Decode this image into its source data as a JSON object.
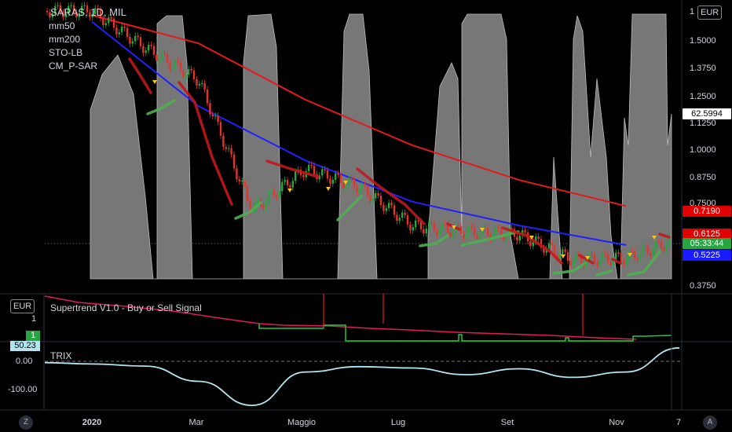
{
  "header": {
    "symbol": "SARAS, 1D, MIL",
    "indicators": [
      "mm50",
      "mm200",
      "STO-LB",
      "CM_P-SAR"
    ]
  },
  "currency": "EUR",
  "price_axis": {
    "ticks": [
      "1.5000",
      "1.3750",
      "1.2500",
      "1.1250",
      "1.0000",
      "0.8750",
      "0.7500",
      "0.3750"
    ],
    "top_partial": "1",
    "tags": [
      {
        "text": "62.5994",
        "bg": "#ffffff",
        "fg": "#000000"
      },
      {
        "text": "0.7190",
        "bg": "#e00000",
        "fg": "#ffffff"
      },
      {
        "text": "0.6125",
        "bg": "#e00000",
        "fg": "#ffffff"
      },
      {
        "text": "05:33:44",
        "bg": "#26a641",
        "fg": "#ffffff"
      },
      {
        "text": "0.5225",
        "bg": "#1a1aff",
        "fg": "#ffffff"
      }
    ]
  },
  "panes": {
    "supertrend": {
      "title": "Supertrend V1.0 - Buy or Sell Signal",
      "currency": "EUR",
      "tick": "1",
      "tag": "1"
    },
    "trix": {
      "title": "TRIX",
      "tag": "50.23",
      "ticks": [
        "0.00",
        "-100.00"
      ]
    }
  },
  "time_axis": {
    "labels": [
      "2020",
      "Mar",
      "Maggio",
      "Lug",
      "Set",
      "Nov",
      "7"
    ]
  },
  "footer": {
    "left_btn": "Z",
    "right_btn": "A"
  },
  "colors": {
    "ma50": "#2020ff",
    "ma200": "#e31a1c",
    "up": "#26a641",
    "down": "#e3342f",
    "stoch_fill": "#8c8c8c",
    "sar_up": "#4caf50",
    "sar_down": "#c0181b",
    "trix": "#b3e5f0"
  },
  "chart_data": [
    {
      "type": "line",
      "title": "SARAS, 1D, MIL",
      "series": [
        {
          "name": "mm50",
          "x": [
            "2020-01",
            "2020-03",
            "2020-05",
            "2020-07",
            "2020-09",
            "2020-11"
          ],
          "values": [
            1.57,
            1.18,
            0.93,
            0.74,
            0.63,
            0.54
          ]
        },
        {
          "name": "mm200",
          "x": [
            "2020-01",
            "2020-03",
            "2020-05",
            "2020-07",
            "2020-09",
            "2020-11"
          ],
          "values": [
            1.6,
            1.47,
            1.21,
            1.0,
            0.84,
            0.72
          ]
        },
        {
          "name": "close",
          "x": [
            "2020-01",
            "2020-02",
            "2020-03",
            "2020-04",
            "2020-05",
            "2020-06",
            "2020-07",
            "2020-08",
            "2020-09",
            "2020-10",
            "2020-11",
            "2020-12"
          ],
          "values": [
            1.62,
            1.45,
            1.3,
            0.7,
            0.89,
            0.81,
            0.63,
            0.6,
            0.59,
            0.47,
            0.48,
            0.57
          ]
        }
      ],
      "ylim": [
        0.35,
        1.65
      ]
    },
    {
      "type": "line",
      "title": "TRIX",
      "series": [
        {
          "name": "TRIX",
          "x": [
            "2020-01",
            "2020-02",
            "2020-03",
            "2020-04",
            "2020-05",
            "2020-06",
            "2020-07",
            "2020-08",
            "2020-09",
            "2020-10",
            "2020-11",
            "2020-12"
          ],
          "values": [
            -10,
            -18,
            -75,
            -165,
            -40,
            -20,
            -25,
            -50,
            -28,
            -60,
            -40,
            50.23
          ]
        }
      ]
    }
  ]
}
